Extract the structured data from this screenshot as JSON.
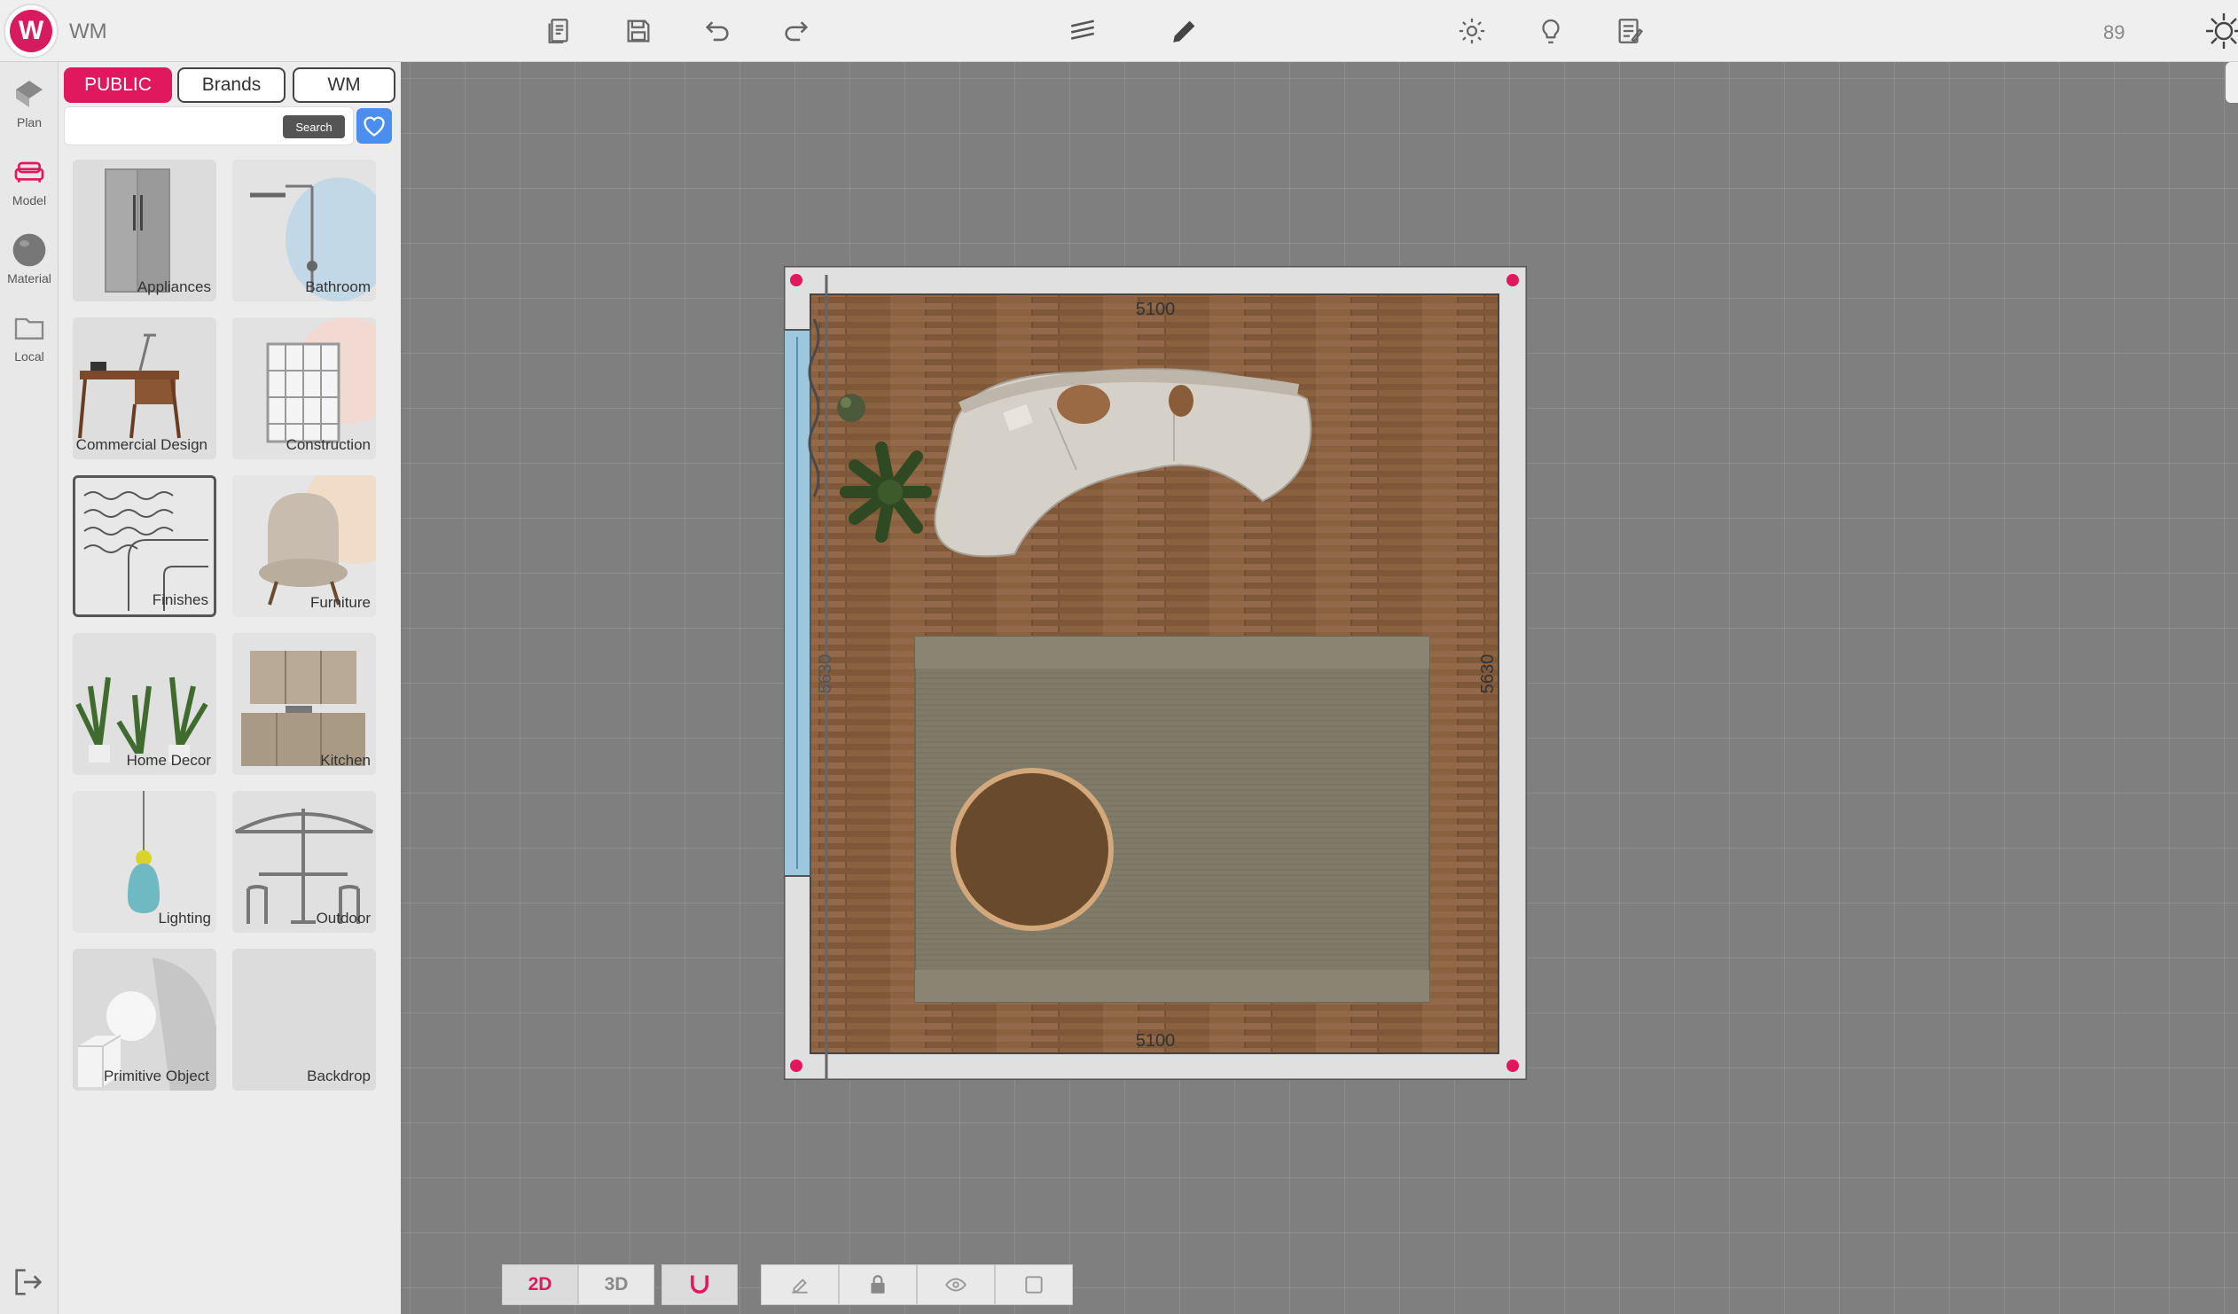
{
  "app": {
    "logo_letter": "W",
    "title": "WM",
    "counter": "89"
  },
  "toolbar": {
    "icons": [
      "document-icon",
      "save-icon",
      "undo-icon",
      "redo-icon",
      "layers-icon",
      "pencil-icon",
      "settings-icon",
      "lightbulb-icon",
      "report-icon"
    ]
  },
  "rail": {
    "items": [
      {
        "label": "Plan",
        "icon": "plan-icon"
      },
      {
        "label": "Model",
        "icon": "sofa-icon"
      },
      {
        "label": "Material",
        "icon": "sphere-icon"
      },
      {
        "label": "Local",
        "icon": "folder-icon"
      }
    ]
  },
  "catalog": {
    "tabs": [
      "PUBLIC",
      "Brands",
      "WM"
    ],
    "active_tab": "PUBLIC",
    "search_placeholder": "",
    "search_button": "Search",
    "categories": [
      "Appliances",
      "Bathroom",
      "Commercial Design",
      "Construction",
      "Finishes",
      "Furniture",
      "Home Decor",
      "Kitchen",
      "Lighting",
      "Outdoor",
      "Primitive Object",
      "Backdrop"
    ]
  },
  "plan": {
    "dim_top": "5100",
    "dim_bottom": "5100",
    "dim_left": "5630",
    "dim_right": "5630"
  },
  "view_controls": {
    "mode_2d": "2D",
    "mode_3d": "3D",
    "active_mode": "2D"
  },
  "colors": {
    "accent": "#e0195f",
    "favorite": "#4a8ff0",
    "floor": "#8a6240",
    "rug": "#807a68"
  }
}
